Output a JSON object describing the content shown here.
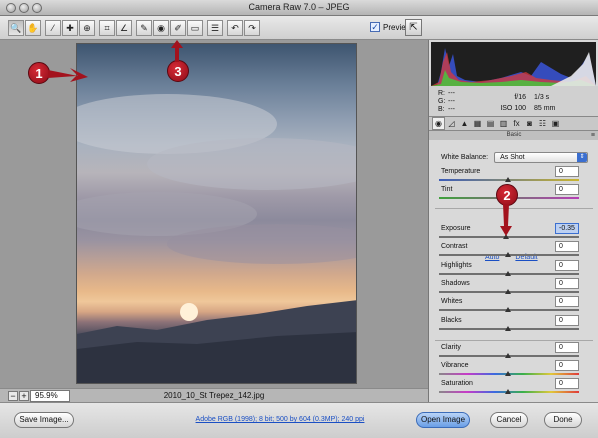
{
  "window": {
    "title": "Camera Raw 7.0  –  JPEG"
  },
  "toolbar": {
    "tools": [
      {
        "icon": "zoom-icon",
        "glyph": "🔍"
      },
      {
        "icon": "hand-icon",
        "glyph": "✋"
      },
      {
        "icon": "white-balance-icon",
        "glyph": "⁄"
      },
      {
        "icon": "color-sampler-icon",
        "glyph": "✚"
      },
      {
        "icon": "targeted-adjustment-icon",
        "glyph": "⊕"
      },
      {
        "icon": "crop-icon",
        "glyph": "⌗"
      },
      {
        "icon": "straighten-icon",
        "glyph": "∠"
      },
      {
        "icon": "spot-removal-icon",
        "glyph": "✎"
      },
      {
        "icon": "red-eye-icon",
        "glyph": "◉"
      },
      {
        "icon": "adjustment-brush-icon",
        "glyph": "✐"
      },
      {
        "icon": "graduated-filter-icon",
        "glyph": "▭"
      },
      {
        "icon": "preferences-icon",
        "glyph": "☰"
      },
      {
        "icon": "rotate-left-icon",
        "glyph": "↶"
      },
      {
        "icon": "rotate-right-icon",
        "glyph": "↷"
      }
    ],
    "preview_label": "Preview",
    "preview_checked": true
  },
  "preview": {
    "zoom": "95.9%",
    "filename": "2010_10_St Trepez_142.jpg"
  },
  "readout": {
    "r_label": "R:",
    "g_label": "G:",
    "b_label": "B:",
    "r": "---",
    "g": "---",
    "b": "---",
    "aperture": "f/16",
    "shutter": "1/3 s",
    "iso": "ISO 100",
    "focal": "85 mm"
  },
  "panel": {
    "name": "Basic",
    "white_balance_label": "White Balance:",
    "white_balance_value": "As Shot",
    "auto": "Auto",
    "default": "Default",
    "sliders": [
      {
        "label": "Temperature",
        "value": "0"
      },
      {
        "label": "Tint",
        "value": "0"
      },
      {
        "label": "Exposure",
        "value": "-0.35"
      },
      {
        "label": "Contrast",
        "value": "0"
      },
      {
        "label": "Highlights",
        "value": "0"
      },
      {
        "label": "Shadows",
        "value": "0"
      },
      {
        "label": "Whites",
        "value": "0"
      },
      {
        "label": "Blacks",
        "value": "0"
      },
      {
        "label": "Clarity",
        "value": "0"
      },
      {
        "label": "Vibrance",
        "value": "0"
      },
      {
        "label": "Saturation",
        "value": "0"
      }
    ]
  },
  "bottom": {
    "save_image": "Save Image...",
    "workflow": "Adobe RGB (1998); 8 bit; 500 by 604 (0.3MP); 240 ppi",
    "open_image": "Open Image",
    "cancel": "Cancel",
    "done": "Done"
  },
  "callouts": [
    "1",
    "2",
    "3"
  ],
  "colors": {
    "accent": "#3b6fd0",
    "callout": "#b5141f"
  }
}
